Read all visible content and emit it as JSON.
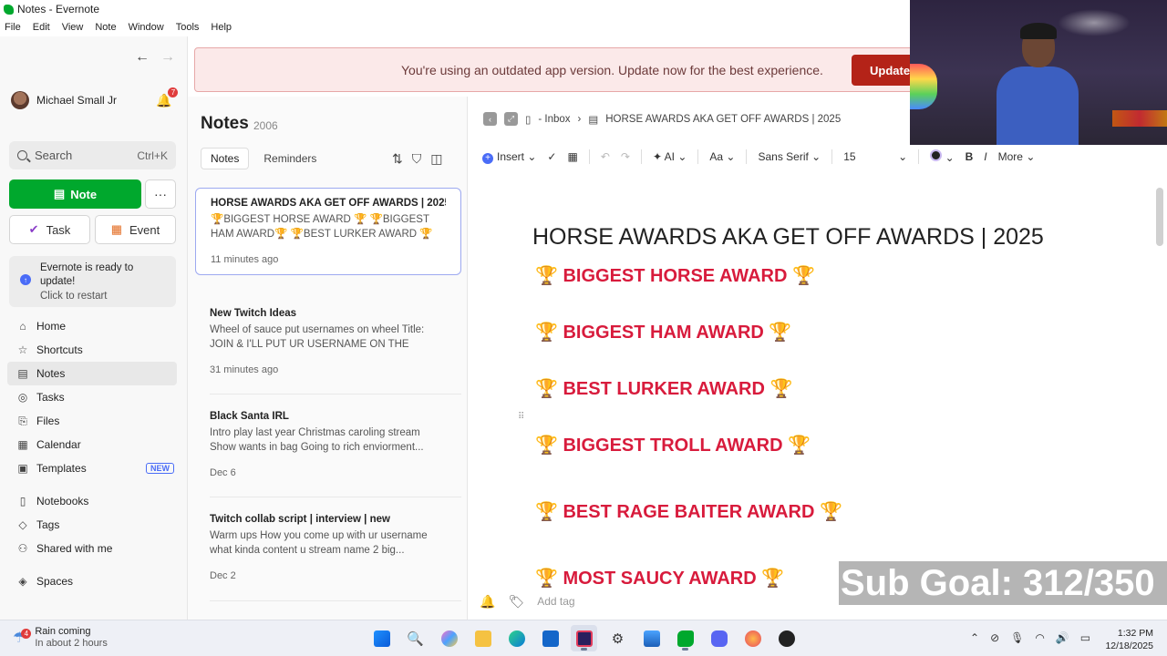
{
  "window": {
    "title": "Notes - Evernote"
  },
  "menu": [
    "File",
    "Edit",
    "View",
    "Note",
    "Window",
    "Tools",
    "Help"
  ],
  "sidebar": {
    "user_name": "Michael Small Jr",
    "notification_count": "7",
    "search_placeholder": "Search",
    "search_shortcut": "Ctrl+K",
    "note_button": "Note",
    "task_button": "Task",
    "event_button": "Event",
    "update_title": "Evernote is ready to update!",
    "update_sub": "Click to restart",
    "nav_top": [
      {
        "label": "Home",
        "icon": "home-icon"
      },
      {
        "label": "Shortcuts",
        "icon": "star-icon"
      },
      {
        "label": "Notes",
        "icon": "notes-icon"
      },
      {
        "label": "Tasks",
        "icon": "tasks-icon"
      },
      {
        "label": "Files",
        "icon": "files-icon"
      },
      {
        "label": "Calendar",
        "icon": "calendar-icon"
      },
      {
        "label": "Templates",
        "icon": "templates-icon",
        "badge": "NEW"
      }
    ],
    "nav_bottom": [
      {
        "label": "Notebooks",
        "icon": "notebook-icon"
      },
      {
        "label": "Tags",
        "icon": "tag-icon"
      },
      {
        "label": "Shared with me",
        "icon": "shared-icon"
      }
    ],
    "spaces_label": "Spaces"
  },
  "banner": {
    "text": "You're using an outdated app version. Update now for the best experience.",
    "button": "Update"
  },
  "notes_list": {
    "title": "Notes",
    "count": "2006",
    "tabs": [
      "Notes",
      "Reminders"
    ],
    "items": [
      {
        "title": "HORSE AWARDS AKA GET OFF AWARDS | 2025",
        "preview": "🏆BIGGEST HORSE AWARD 🏆 🏆BIGGEST HAM AWARD🏆 🏆BEST LURKER AWARD 🏆 🏆...",
        "date": "11 minutes ago"
      },
      {
        "title": "New Twitch Ideas",
        "preview": "Wheel of sauce put usernames on wheel Title: JOIN & I'LL PUT UR USERNAME ON THE WHEEL...",
        "date": "31 minutes ago"
      },
      {
        "title": "Black Santa IRL",
        "preview": "Intro play last year Christmas caroling stream Show wants in bag Going to rich enviorment...",
        "date": "Dec 6"
      },
      {
        "title": "Twitch collab script | interview | new",
        "preview": "Warm ups How you come up with ur username what kinda content u stream name 2 big...",
        "date": "Dec 2"
      }
    ]
  },
  "editor": {
    "breadcrumb_notebook": "- Inbox",
    "breadcrumb_note": "HORSE AWARDS AKA GET OFF AWARDS | 2025",
    "toolbar": {
      "insert": "Insert",
      "ai": "AI",
      "font_family": "Sans Serif",
      "font_size": "15",
      "more": "More"
    },
    "title": "HORSE AWARDS AKA GET OFF AWARDS | 2025",
    "awards": [
      "🏆 BIGGEST HORSE AWARD 🏆",
      "🏆 BIGGEST HAM AWARD 🏆",
      "🏆 BEST LURKER AWARD 🏆",
      "🏆  BIGGEST TROLL AWARD 🏆",
      "🏆  BEST RAGE BAITER AWARD 🏆",
      "🏆 MOST SAUCY AWARD 🏆"
    ],
    "add_tag": "Add tag",
    "award_color": "#d81b3c"
  },
  "overlay": {
    "sub_goal": "Sub Goal: 312/350"
  },
  "taskbar": {
    "weather_title": "Rain coming",
    "weather_sub": "In about 2 hours",
    "weather_badge": "4",
    "time": "1:32 PM",
    "date": "12/18/2025"
  }
}
